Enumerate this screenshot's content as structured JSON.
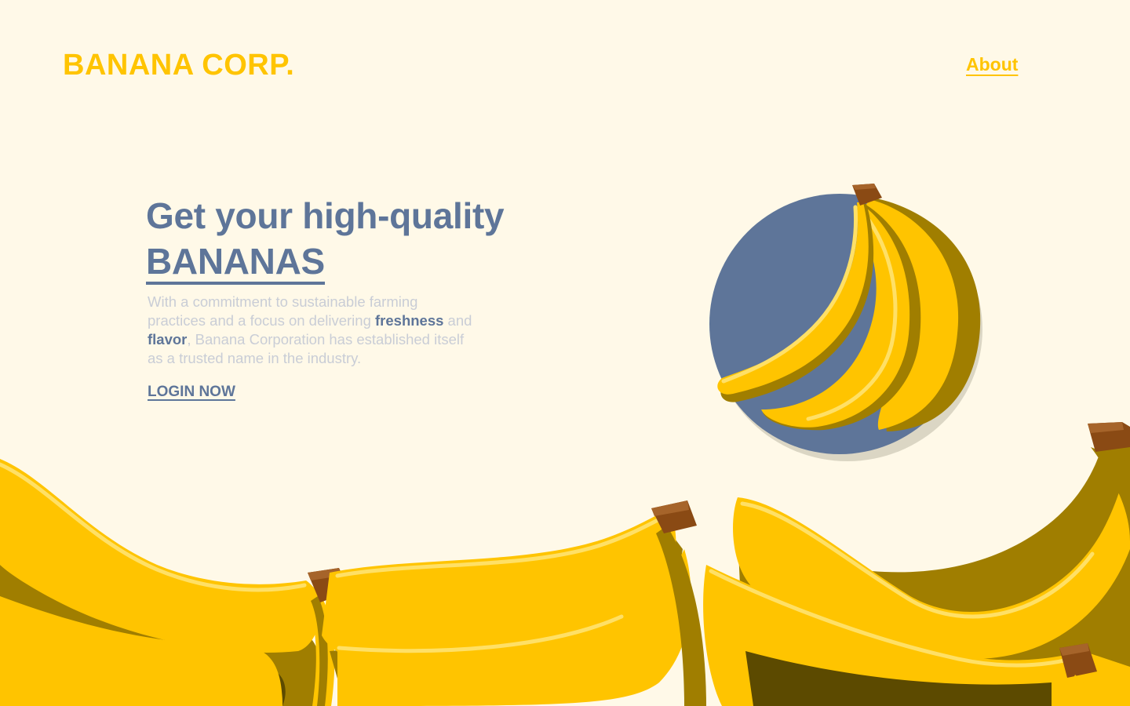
{
  "header": {
    "logo": "BANANA CORP.",
    "nav": {
      "about_label": "About"
    }
  },
  "hero": {
    "title_line1": "Get your high-quality",
    "title_highlight": "BANANAS",
    "description": {
      "part1": "With a commitment to sustainable farming practices and a focus on delivering ",
      "emph1": "freshness",
      "part2": " and ",
      "emph2": "flavor",
      "part3": ", Banana Corporation has established itself as a trusted name in the industry."
    },
    "cta_label": "LOGIN NOW"
  },
  "colors": {
    "background": "#FFF9E8",
    "brand_yellow": "#FFC400",
    "accent_blue": "#5E7599",
    "muted_text": "#C9CDD6",
    "banana_shadow": "#A07E00",
    "banana_stem": "#8A4A14"
  },
  "icons": {
    "hero_image": "banana-bunch-illustration",
    "decor": "banana-pile-illustration"
  }
}
